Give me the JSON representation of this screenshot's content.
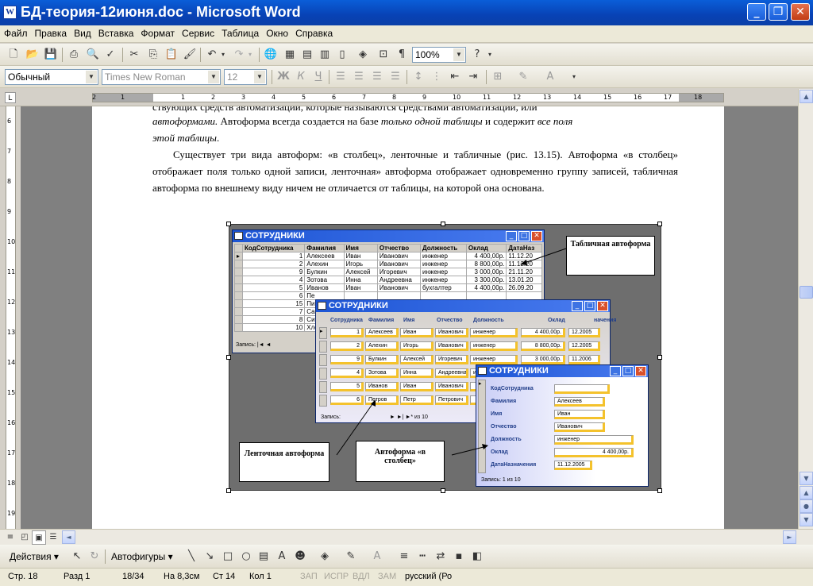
{
  "window": {
    "title": "БД-теория-12июня.doc - Microsoft Word",
    "icon_letter": "W"
  },
  "menu": [
    "Файл",
    "Правка",
    "Вид",
    "Вставка",
    "Формат",
    "Сервис",
    "Таблица",
    "Окно",
    "Справка"
  ],
  "toolbar": {
    "zoom": "100%"
  },
  "format": {
    "style": "Обычный",
    "font": "Times New Roman",
    "size": "12"
  },
  "ruler": {
    "top_numbers": [
      "2",
      "1",
      "1",
      "2",
      "3",
      "4",
      "5",
      "6",
      "7",
      "8",
      "9",
      "10",
      "11",
      "12",
      "13",
      "14",
      "15",
      "16",
      "17",
      "18"
    ],
    "left_numbers": [
      "6",
      "7",
      "8",
      "9",
      "10",
      "11",
      "12",
      "13",
      "14",
      "15",
      "16",
      "17",
      "18",
      "19"
    ]
  },
  "document": {
    "p1_line1": "ствующих средств автоматизации, которые называются средствами автоматизации, или",
    "p1_line2_em": "автоформами.",
    "p1_line2_a": " Автоформа всегда создается на базе ",
    "p1_line2_em2": "только одной таблицы",
    "p1_line2_b": " и содержит ",
    "p1_line2_em3": "все поля",
    "p1_line3_em": "этой таблицы",
    "p1_line3_end": ".",
    "p2": "Существует три вида автоформ: «в столбец», ленточные и табличные (рис. 13.15). Автоформа «в столбец» отображает поля только одной записи, ленточная» автоформа отображает одновременно группу записей, табличная автоформа по внешнему виду ничем не отличается от таблицы, на которой она основана."
  },
  "figure": {
    "window_title": "СОТРУДНИКИ",
    "table_headers": [
      "КодСотрудника",
      "Фамилия",
      "Имя",
      "Отчество",
      "Должность",
      "Оклад",
      "ДатаНаз"
    ],
    "table_rows": [
      [
        "1",
        "Алексеев",
        "Иван",
        "Иванович",
        "инженер",
        "4 400,00р.",
        "11.12.20"
      ],
      [
        "2",
        "Алехин",
        "Игорь",
        "Иванович",
        "инженер",
        "8 800,00р.",
        "11.12.20"
      ],
      [
        "9",
        "Булкин",
        "Алексей",
        "Игоревич",
        "инженер",
        "3 000,00р.",
        "21.11.20"
      ],
      [
        "4",
        "Зотова",
        "Инна",
        "Андреевна",
        "инженер",
        "3 300,00р.",
        "13.01.20"
      ],
      [
        "5",
        "Иванов",
        "Иван",
        "Иванович",
        "бухгалтер",
        "4 400,00р.",
        "26.09.20"
      ],
      [
        "6",
        "Пе",
        "",
        "",
        "",
        "",
        ""
      ],
      [
        "15",
        "Пи",
        "",
        "",
        "",
        "",
        ""
      ],
      [
        "7",
        "Са",
        "",
        "",
        "",
        "",
        ""
      ],
      [
        "8",
        "Си",
        "",
        "",
        "",
        "",
        ""
      ],
      [
        "10",
        "Хле",
        "",
        "",
        "",
        "",
        ""
      ]
    ],
    "record_label": "Запись:",
    "of_label": "из 10",
    "tape_headers": [
      "Сотрудника",
      "Фамилия",
      "Имя",
      "Отчество",
      "Должность",
      "Оклад",
      "начения"
    ],
    "tape_rows": [
      [
        "1",
        "Алексеев",
        "Иван",
        "Иванович",
        "инженер",
        "4 400,00р.",
        "12.2005"
      ],
      [
        "2",
        "Алехин",
        "Игорь",
        "Иванович",
        "инженер",
        "8 800,00р.",
        "12.2005"
      ],
      [
        "9",
        "Булкин",
        "Алексей",
        "Игоревич",
        "инженер",
        "3 000,00р.",
        "11.2006"
      ],
      [
        "4",
        "Зотова",
        "Инна",
        "Андреевна",
        "инженер",
        "",
        ""
      ],
      [
        "5",
        "Иванов",
        "Иван",
        "Иванович",
        "",
        "",
        ""
      ],
      [
        "6",
        "Петров",
        "Петр",
        "Петрович",
        "",
        "",
        ""
      ]
    ],
    "col_labels": [
      "КодСотрудника",
      "Фамилия",
      "Имя",
      "Отчество",
      "Должность",
      "Оклад",
      "ДатаНазначения"
    ],
    "col_values": [
      "",
      "Алексеев",
      "Иван",
      "Иванович",
      "инженер",
      "4 400,00р.",
      "11.12.2005"
    ],
    "record_num": "1",
    "callout_table": "Табличная автоформа",
    "callout_tape": "Ленточная автоформа",
    "callout_column": "Автоформа «в столбец»"
  },
  "drawbar": {
    "actions": "Действия",
    "autoshapes": "Автофигуры"
  },
  "status": {
    "page": "Стр. 18",
    "section": "Разд 1",
    "pages": "18/34",
    "at": "На 8,3см",
    "line": "Ст 14",
    "col": "Кол 1",
    "rec": "ЗАП",
    "trk": "ИСПР",
    "ext": "ВДЛ",
    "ovr": "ЗАМ",
    "lang": "русский (Ро"
  }
}
